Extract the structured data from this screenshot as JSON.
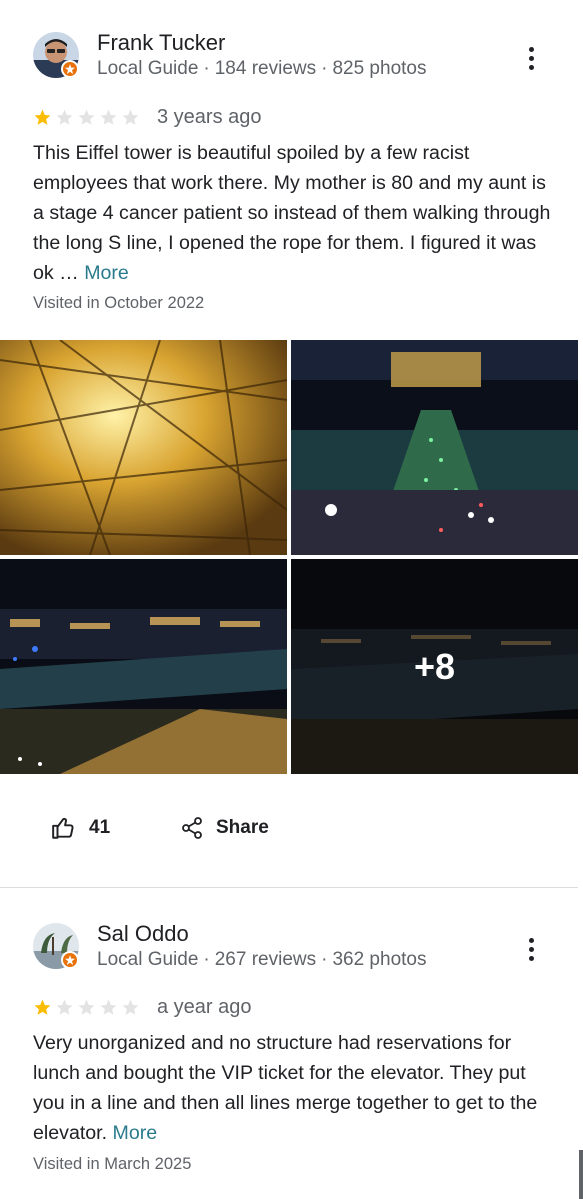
{
  "reviews": [
    {
      "author": "Frank Tucker",
      "role": "Local Guide",
      "review_count": "184 reviews",
      "photo_count": "825 photos",
      "rating": 1,
      "max_rating": 5,
      "age": "3 years ago",
      "text": "This Eiffel tower is beautiful spoiled by a few racist employees that work there. My mother is 80 and my aunt is a stage 4 cancer patient so instead of them walking through the long S line, I opened the rope for them.  I figured it was ok …",
      "more_label": "More",
      "visited": "Visited in October 2022",
      "more_photos": "+8",
      "likes": "41",
      "share_label": "Share"
    },
    {
      "author": "Sal Oddo",
      "role": "Local Guide",
      "review_count": "267 reviews",
      "photo_count": "362 photos",
      "rating": 1,
      "max_rating": 5,
      "age": "a year ago",
      "text": "Very unorganized and no structure had reservations for lunch and bought the VIP ticket for the elevator. They put you in a line and then all lines merge together to get to the elevator.",
      "more_label": "More",
      "visited": "Visited in March 2025"
    }
  ],
  "colors": {
    "star_filled": "#fbbc04",
    "star_empty": "#dadce0",
    "badge": "#e8710a",
    "link": "#2a7a8c"
  },
  "icons": [
    "more-vert-icon",
    "star-icon",
    "thumb-up-icon",
    "share-icon",
    "local-guide-badge-icon"
  ]
}
